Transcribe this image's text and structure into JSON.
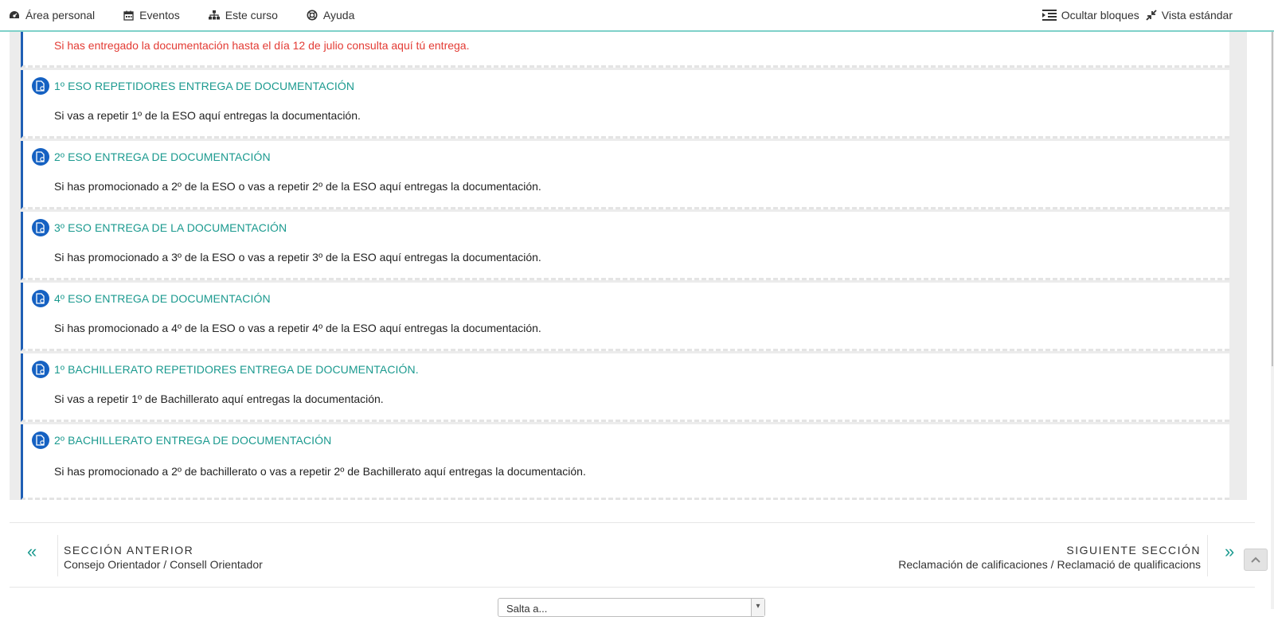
{
  "navbar": {
    "items": [
      {
        "label": "Área personal",
        "icon": "dashboard-icon"
      },
      {
        "label": "Eventos",
        "icon": "calendar-icon"
      },
      {
        "label": "Este curso",
        "icon": "sitemap-icon"
      },
      {
        "label": "Ayuda",
        "icon": "lifebuoy-icon"
      }
    ],
    "hide_blocks_label": "Ocultar bloques",
    "standard_view_label": "Vista estándar"
  },
  "section": {
    "red_note": "Si has entregado la documentación hasta el día 12 de julio consulta aquí tú entrega.",
    "activities": [
      {
        "title": "1º ESO REPETIDORES ENTREGA DE DOCUMENTACIÓN",
        "desc": "Si vas a repetir 1º de la ESO aquí entregas la documentación."
      },
      {
        "title": "2º ESO ENTREGA DE DOCUMENTACIÓN",
        "desc": "Si has promocionado a 2º de la ESO o vas a repetir 2º de la ESO aquí entregas la documentación."
      },
      {
        "title": "3º ESO ENTREGA DE LA DOCUMENTACIÓN",
        "desc": "Si has promocionado a 3º de la ESO o vas a repetir 3º de la ESO aquí entregas la documentación."
      },
      {
        "title": "4º ESO ENTREGA DE DOCUMENTACIÓN",
        "desc": "Si has promocionado a 4º de la ESO o vas a repetir 4º de la ESO aquí entregas la documentación."
      },
      {
        "title": "1º BACHILLERATO REPETIDORES ENTREGA DE DOCUMENTACIÓN.",
        "desc": "Si vas a repetir 1º de Bachillerato aquí entregas la documentación."
      },
      {
        "title": "2º BACHILLERATO ENTREGA DE DOCUMENTACIÓN",
        "desc": "Si has promocionado a 2º de bachillerato o vas a repetir 2º de Bachillerato aquí entregas la documentación."
      }
    ]
  },
  "section_nav": {
    "prev_label": "SECCIÓN ANTERIOR",
    "prev_name": "Consejo Orientador / Consell Orientador",
    "next_label": "SIGUIENTE SECCIÓN",
    "next_name": "Reclamación de calificaciones / Reclamació de qualificacions",
    "prev_arrow": "«",
    "next_arrow": "»"
  },
  "jump_select": {
    "value": "Salta a..."
  },
  "colors": {
    "accent": "#1b9a8f",
    "activity_border": "#1f5fb5",
    "icon_bg": "#1561c2",
    "note_red": "#e33b34",
    "navbar_border": "#7fd1c9"
  }
}
